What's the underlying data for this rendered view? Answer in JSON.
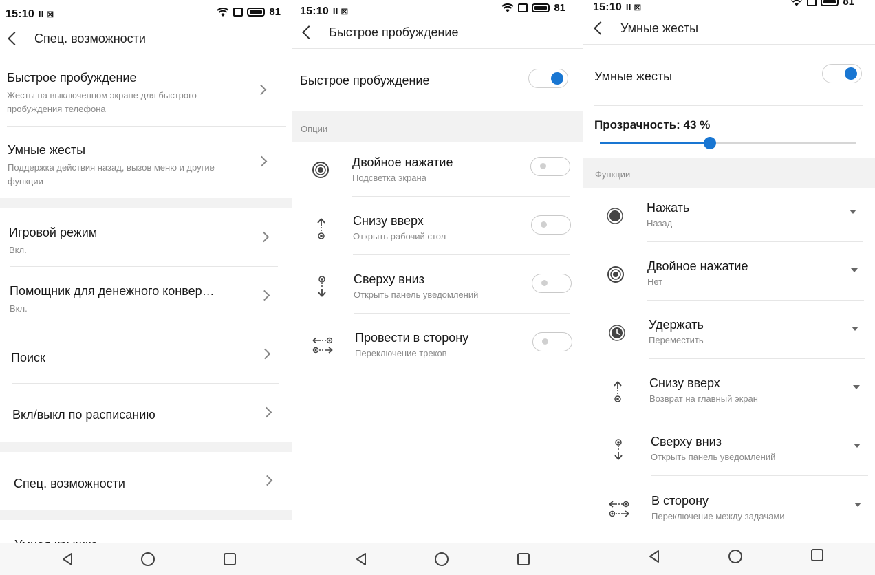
{
  "status": {
    "time": "15:10",
    "extra": "II ⊠",
    "battery": "81"
  },
  "screen1": {
    "title": "Спец. возможности",
    "items": [
      {
        "title": "Быстрое пробуждение",
        "sub": "Жесты на выключенном экране для быстрого пробуждения телефона"
      },
      {
        "title": "Умные жесты",
        "sub": "Поддержка действия назад, вызов меню и другие функции"
      },
      {
        "title": "Игровой режим",
        "sub": "Вкл."
      },
      {
        "title": "Помощник для денежного конвер…",
        "sub": "Вкл."
      },
      {
        "title": "Поиск",
        "sub": ""
      },
      {
        "title": "Вкл/выкл по расписанию",
        "sub": ""
      },
      {
        "title": "Спец. возможности",
        "sub": ""
      },
      {
        "title": "Умная крышка",
        "sub": ""
      }
    ]
  },
  "screen2": {
    "title": "Быстрое пробуждение",
    "main_toggle_label": "Быстрое пробуждение",
    "main_toggle_on": true,
    "section": "Опции",
    "options": [
      {
        "icon": "double-tap-icon",
        "title": "Двойное нажатие",
        "sub": "Подсветка экрана"
      },
      {
        "icon": "swipe-up-icon",
        "title": "Снизу вверх",
        "sub": "Открыть рабочий стол"
      },
      {
        "icon": "swipe-down-icon",
        "title": "Сверху вниз",
        "sub": "Открыть панель уведомлений"
      },
      {
        "icon": "swipe-side-icon",
        "title": "Провести в сторону",
        "sub": "Переключение треков"
      }
    ]
  },
  "screen3": {
    "title": "Умные жесты",
    "main_toggle_label": "Умные жесты",
    "main_toggle_on": true,
    "transparency_label": "Прозрачность: 43 %",
    "transparency_value": 43,
    "section": "Функции",
    "functions": [
      {
        "icon": "tap-icon",
        "title": "Нажать",
        "sub": "Назад"
      },
      {
        "icon": "double-tap-icon",
        "title": "Двойное нажатие",
        "sub": "Нет"
      },
      {
        "icon": "hold-icon",
        "title": "Удержать",
        "sub": "Переместить"
      },
      {
        "icon": "swipe-up-icon",
        "title": "Снизу вверх",
        "sub": "Возврат на главный экран"
      },
      {
        "icon": "swipe-down-icon",
        "title": "Сверху вниз",
        "sub": "Открыть панель уведомлений"
      },
      {
        "icon": "swipe-side-icon",
        "title": "В сторону",
        "sub": "Переключение между задачами"
      }
    ]
  },
  "colors": {
    "accent": "#1976d2",
    "section_band": "#f2f2f2",
    "divider": "#e6e6e6"
  }
}
